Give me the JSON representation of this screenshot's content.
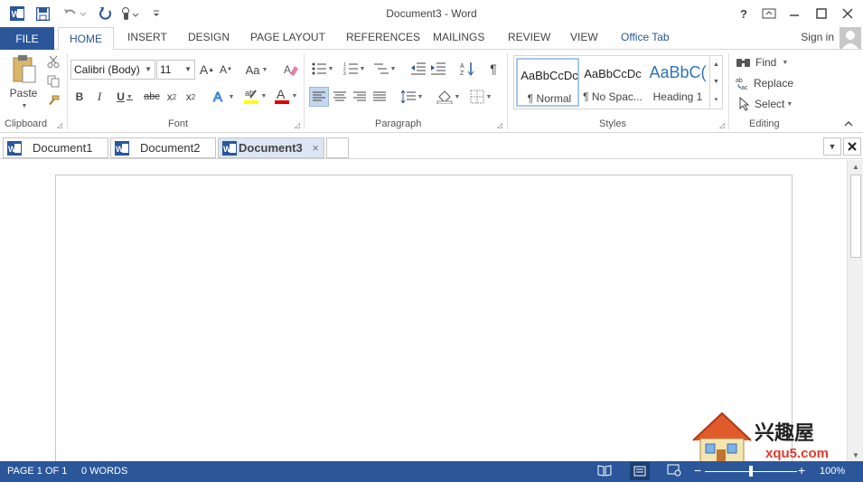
{
  "title_bar": {
    "document_title": "Document3 - Word",
    "help": "?",
    "icons": [
      "word-app-icon",
      "save-icon",
      "undo-icon",
      "redo-icon",
      "touch-mode-icon",
      "customize-qat-icon",
      "ribbon-display-icon",
      "minimize-icon",
      "maximize-icon",
      "close-icon"
    ]
  },
  "ribbon_tabs": {
    "file": "FILE",
    "tabs": [
      "HOME",
      "INSERT",
      "DESIGN",
      "PAGE LAYOUT",
      "REFERENCES",
      "MAILINGS",
      "REVIEW",
      "VIEW",
      "Office Tab"
    ],
    "sign_in": "Sign in"
  },
  "ribbon": {
    "clipboard": {
      "label": "Clipboard",
      "paste": "Paste"
    },
    "font": {
      "label": "Font",
      "font_name": "Calibri (Body)",
      "font_size": "11",
      "change_case": "Aa"
    },
    "paragraph": {
      "label": "Paragraph"
    },
    "styles": {
      "label": "Styles",
      "items": [
        {
          "sample": "AaBbCcDc",
          "name": "¶ Normal"
        },
        {
          "sample": "AaBbCcDc",
          "name": "¶ No Spac..."
        },
        {
          "sample": "AaBbC(",
          "name": "Heading 1"
        }
      ]
    },
    "editing": {
      "label": "Editing",
      "find": "Find",
      "replace": "Replace",
      "select": "Select"
    }
  },
  "doc_tabs": [
    "Document1",
    "Document2",
    "Document3"
  ],
  "status_bar": {
    "page": "PAGE 1 OF 1",
    "words": "0 WORDS",
    "zoom": "100%",
    "zoom_level_percent": 100
  },
  "watermark": {
    "text": "兴趣屋",
    "url": "xqu5.com"
  },
  "colors": {
    "accent": "#2b579a",
    "active_tab_bg": "#dce6f4",
    "highlight": "#ffff00",
    "font_color": "#e00000"
  }
}
